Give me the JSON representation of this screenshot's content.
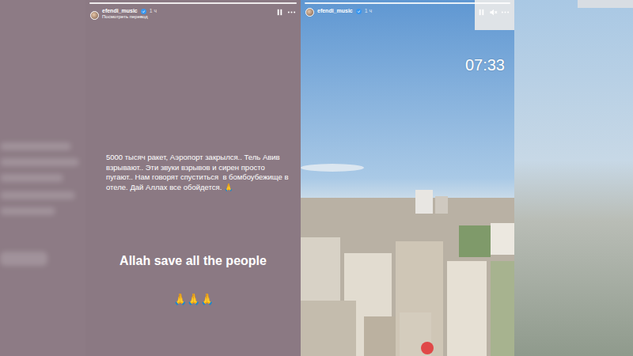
{
  "left_story": {
    "username": "efendi_music",
    "verified": true,
    "time": "1 ч",
    "translate_link": "Посмотреть перевод",
    "paused": true,
    "message": "5000 тысяч ракет, Аэропорт закрылся.. Тель Авив взрывают.. Эти звуки взрывов и сирен просто пугают.. Нам говорят спуститься  в бомбоубежище в отеле. Дай Аллах все обойдется. 🙏",
    "caption": "Allah save all the people",
    "emoji": "🙏🙏🙏"
  },
  "right_story": {
    "username": "efendi_music",
    "verified": true,
    "time": "1 ч",
    "paused": true,
    "muted": true,
    "clock_sticker": "07:33"
  }
}
